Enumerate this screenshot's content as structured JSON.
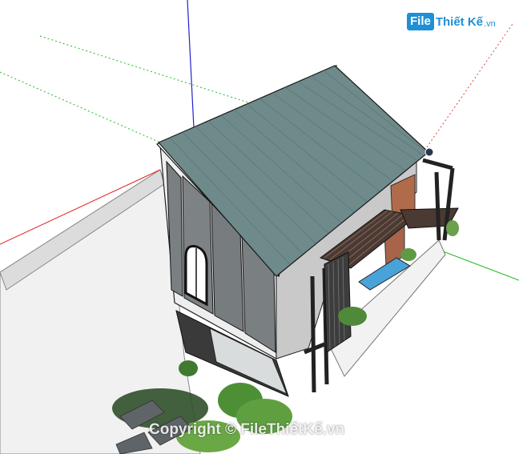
{
  "logo": {
    "badge": "File",
    "rest": "Thiết Kế",
    "ext": ".vn"
  },
  "watermark": {
    "text": "Copyright © FileThiếtKế.vn"
  },
  "colors": {
    "roof": "#6e8a8a",
    "wall_dark": "#787d80",
    "ground": "#f0f0f0",
    "axis_red": "#e02020",
    "axis_green": "#22bb22",
    "axis_blue": "#2222cc",
    "brand": "#1f8fd6"
  }
}
